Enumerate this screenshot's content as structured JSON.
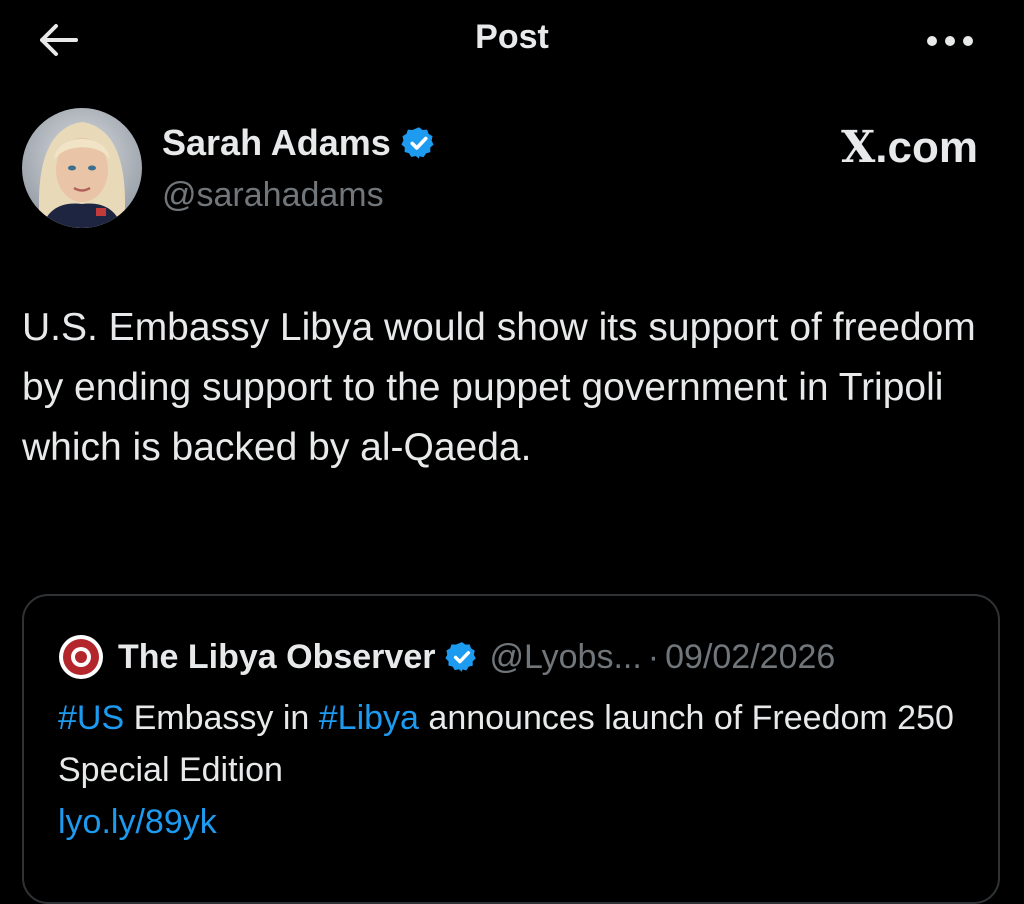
{
  "header": {
    "title": "Post"
  },
  "author": {
    "name": "Sarah Adams",
    "handle": "@sarahadams"
  },
  "source": {
    "label": ".com",
    "logo_letter": "X"
  },
  "post": {
    "text": "U.S. Embassy Libya would show its support of freedom by ending support to the puppet government in Tripoli which is backed by al-Qaeda."
  },
  "quoted_post": {
    "author_name": "The Libya Observer",
    "author_handle": "@Lyobs...",
    "separator": "·",
    "date": "09/02/2026",
    "hashtag_1": "#US",
    "text_1": " Embassy in ",
    "hashtag_2": "#Libya",
    "text_2": " announces launch of Freedom 250 Special Edition",
    "link": "lyo.ly/89yk"
  },
  "colors": {
    "background": "#000000",
    "text": "#e7e9ea",
    "secondary_text": "#71767b",
    "link": "#1d9bf0",
    "verified": "#1d9bf0",
    "border": "#2f3336"
  },
  "icons": {
    "back": "arrow-left-icon",
    "more": "more-horizontal-icon",
    "verified": "verified-badge-icon"
  }
}
